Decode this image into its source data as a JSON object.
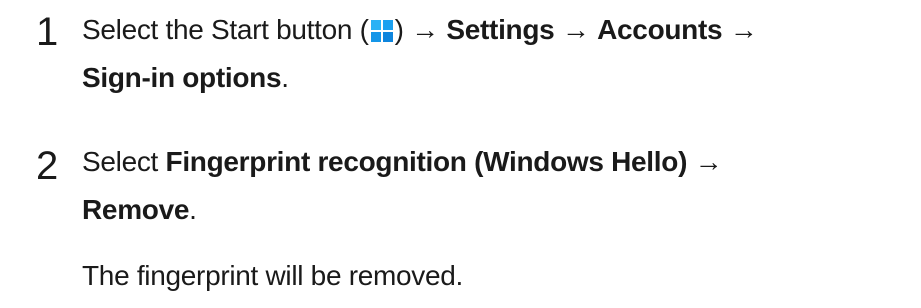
{
  "steps": [
    {
      "number": "1",
      "lines": [
        {
          "before_icon": "Select the Start button (",
          "icon": "windows-start-icon",
          "after_icon": ") →",
          "item1": "Settings",
          "sep1": "→",
          "item2": "Accounts",
          "sep2": "→"
        },
        {
          "item": "Sign-in options",
          "end": "."
        }
      ]
    },
    {
      "number": "2",
      "lines": [
        {
          "prefix": "Select",
          "item": "Fingerprint recognition (Windows Hello)",
          "sep": "→"
        },
        {
          "item": "Remove",
          "end": "."
        }
      ]
    }
  ],
  "result_text": "The fingerprint will be removed.",
  "colors": {
    "text": "#1a1a1a",
    "windows_icon": "#1aa0f0"
  }
}
